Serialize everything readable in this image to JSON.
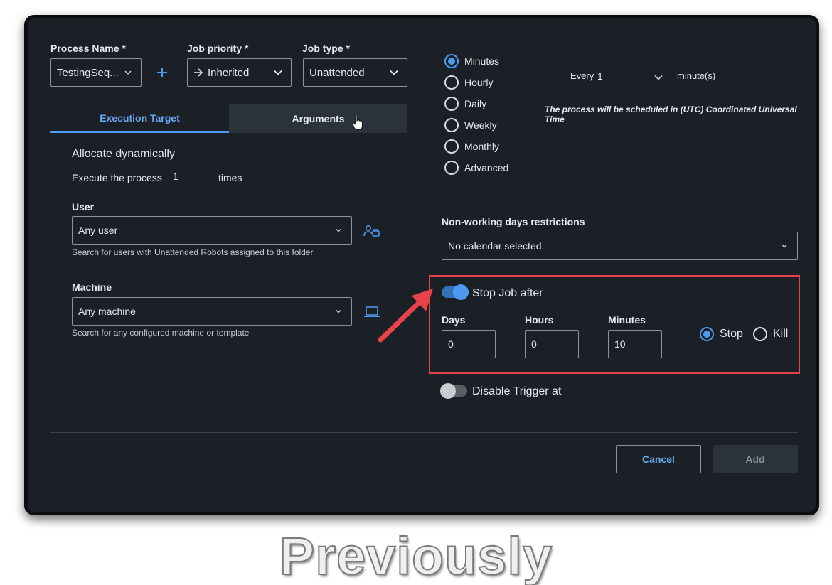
{
  "left": {
    "process_name": {
      "label": "Process Name *",
      "value": "TestingSeq..."
    },
    "job_priority": {
      "label": "Job priority *",
      "value": "Inherited"
    },
    "job_type": {
      "label": "Job type *",
      "value": "Unattended"
    },
    "tabs": [
      {
        "label": "Execution Target"
      },
      {
        "label": "Arguments"
      }
    ],
    "allocate_title": "Allocate dynamically",
    "execute_prefix": "Execute the process",
    "execute_value": "1",
    "execute_suffix": "times",
    "user": {
      "label": "User",
      "value": "Any user",
      "help": "Search for users with Unattended Robots assigned to this folder"
    },
    "machine": {
      "label": "Machine",
      "value": "Any machine",
      "help": "Search for any configured machine or template"
    }
  },
  "right": {
    "frequency_options": [
      {
        "label": "Minutes",
        "selected": true
      },
      {
        "label": "Hourly",
        "selected": false
      },
      {
        "label": "Daily",
        "selected": false
      },
      {
        "label": "Weekly",
        "selected": false
      },
      {
        "label": "Monthly",
        "selected": false
      },
      {
        "label": "Advanced",
        "selected": false
      }
    ],
    "every_label": "Every",
    "every_value": "1",
    "every_unit": "minute(s)",
    "timezone_note": "The process will be scheduled in (UTC) Coordinated Universal Time",
    "nonworking": {
      "label": "Non-working days restrictions",
      "value": "No calendar selected."
    },
    "stop_job": {
      "label": "Stop Job after",
      "enabled": true,
      "days_label": "Days",
      "days_value": "0",
      "hours_label": "Hours",
      "hours_value": "0",
      "minutes_label": "Minutes",
      "minutes_value": "10",
      "stop_label": "Stop",
      "kill_label": "Kill",
      "selected_action": "Stop"
    },
    "disable_trigger": {
      "label": "Disable Trigger at",
      "enabled": false
    }
  },
  "footer": {
    "cancel_label": "Cancel",
    "add_label": "Add"
  },
  "caption": "Previously",
  "colors": {
    "accent": "#4c9bf0",
    "highlight_box": "#e8434b",
    "background": "#1b1f26"
  }
}
